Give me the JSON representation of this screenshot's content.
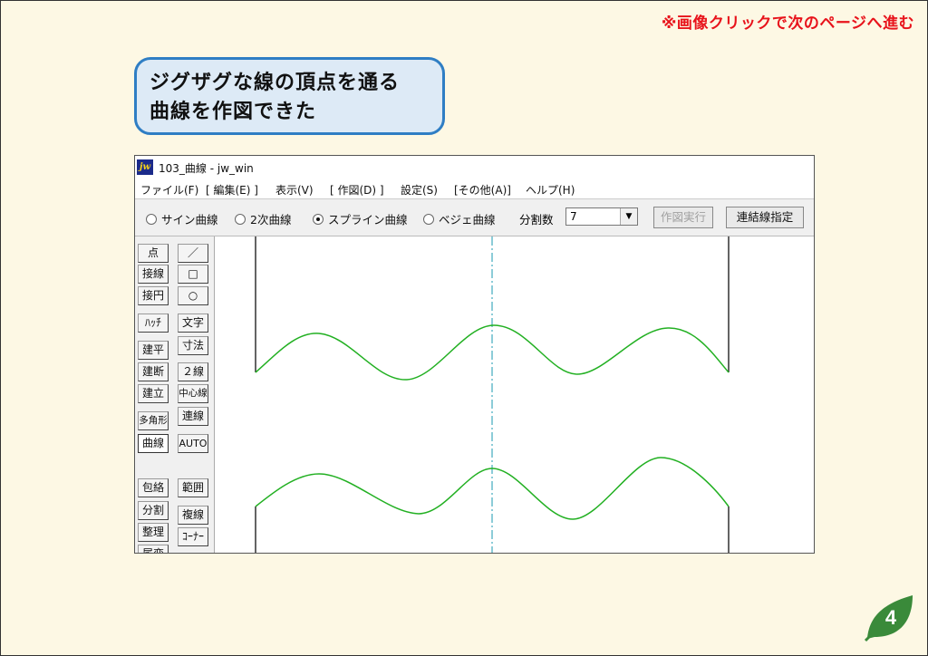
{
  "note": "※画像クリックで次のページへ進む",
  "callout": {
    "line1": "ジグザグな線の頂点を通る",
    "line2": "曲線を作図できた"
  },
  "window": {
    "icon_text": "jw",
    "title": "103_曲線 - jw_win"
  },
  "menu": [
    "ファイル(F)",
    "[ 編集(E) ]",
    "表示(V)",
    "[ 作図(D) ]",
    "設定(S)",
    "[その他(A)]",
    "ヘルプ(H)"
  ],
  "options": {
    "radios": [
      {
        "label": "サイン曲線",
        "selected": false
      },
      {
        "label": "2次曲線",
        "selected": false
      },
      {
        "label": "スプライン曲線",
        "selected": true
      },
      {
        "label": "ベジェ曲線",
        "selected": false
      }
    ],
    "divisions_label": "分割数",
    "divisions_value": "7",
    "execute_button": "作図実行",
    "connect_button": "連結線指定"
  },
  "tools_left": [
    "点",
    "接線",
    "接円",
    "ﾊｯﾁ",
    "建平",
    "建断",
    "建立",
    "多角形",
    "曲線",
    "包絡",
    "分割",
    "整理",
    "属変"
  ],
  "tools_right": [
    "／",
    "□",
    "○",
    "文字",
    "寸法",
    "２線",
    "中心線",
    "連線",
    "AUTO",
    "範囲",
    "複線",
    "ｺｰﾅｰ"
  ],
  "active_tool": "曲線",
  "page_number": "4",
  "colors": {
    "curve": "#22b022",
    "centerline": "#1a9ab0",
    "accent_red": "#e8131b",
    "callout_border": "#2f7ec4",
    "badge": "#3a8a3a"
  }
}
